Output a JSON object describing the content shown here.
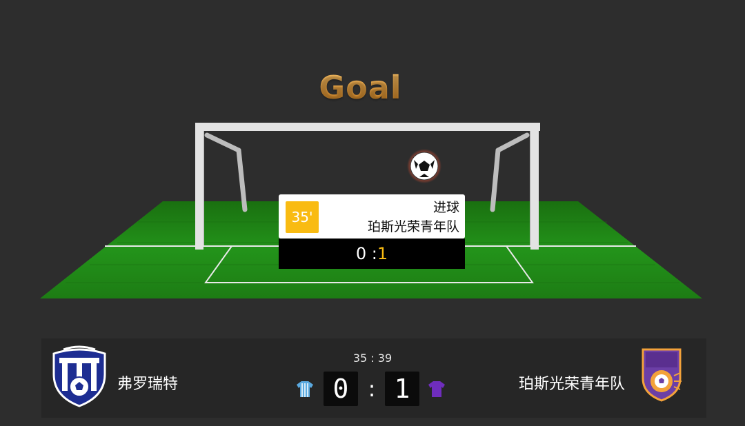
{
  "animation": {
    "title": "Goal"
  },
  "event": {
    "minute": "35'",
    "type": "进球",
    "team": "珀斯光荣青年队",
    "score_home": "0 :",
    "score_away": "1"
  },
  "scoreboard": {
    "clock": "35 : 39",
    "home_team": "弗罗瑞特",
    "away_team": "珀斯光荣青年队",
    "home_score": "0",
    "away_score": "1",
    "separator": ":",
    "home_kit_color": "#5aa9e0",
    "away_kit_color": "#6f2dbd",
    "home_logo_icon": "shield-crest-icon",
    "away_logo_icon": "perth-glory-crest-icon"
  },
  "colors": {
    "background": "#2d2d2d",
    "pitch_green": "#1f8a16",
    "accent_gold": "#f9bb12"
  }
}
